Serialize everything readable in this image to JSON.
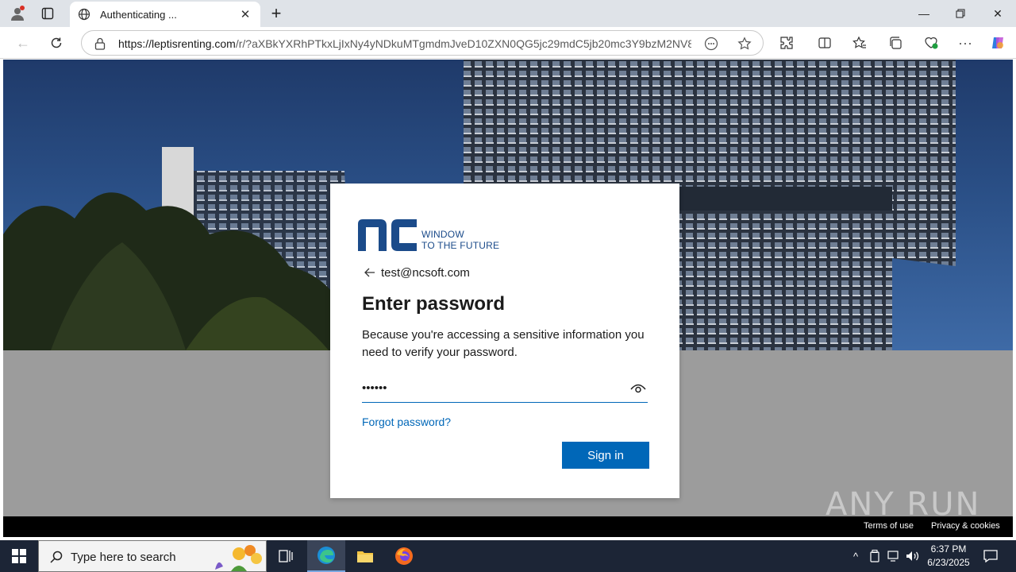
{
  "browser": {
    "tab_title": "Authenticating ...",
    "url_host": "https://leptisrenting.com",
    "url_path": "/r/?aXBkYXRhPTkxLjIxNy4yNDkuMTgmdmJveD10ZXN0QG5jc29mdC5jb20mc3Y9bzM2NV8...",
    "window_controls": [
      "minimize",
      "restore",
      "close"
    ]
  },
  "signin": {
    "logo_line1": "WINDOW",
    "logo_line2": "TO THE FUTURE",
    "identity_email": "test@ncsoft.com",
    "heading": "Enter password",
    "description": "Because you're accessing a sensitive information you need to verify your password.",
    "password_value": "••••••",
    "forgot_link": "Forgot password?",
    "signin_button": "Sign in"
  },
  "footer": {
    "terms": "Terms of use",
    "privacy": "Privacy & cookies"
  },
  "watermark": "ANY RUN",
  "taskbar": {
    "search_placeholder": "Type here to search",
    "time": "6:37 PM",
    "date": "6/23/2025"
  },
  "colors": {
    "accent": "#0067b8",
    "logo_blue": "#1b4b8a",
    "taskbar": "#1c2536"
  }
}
